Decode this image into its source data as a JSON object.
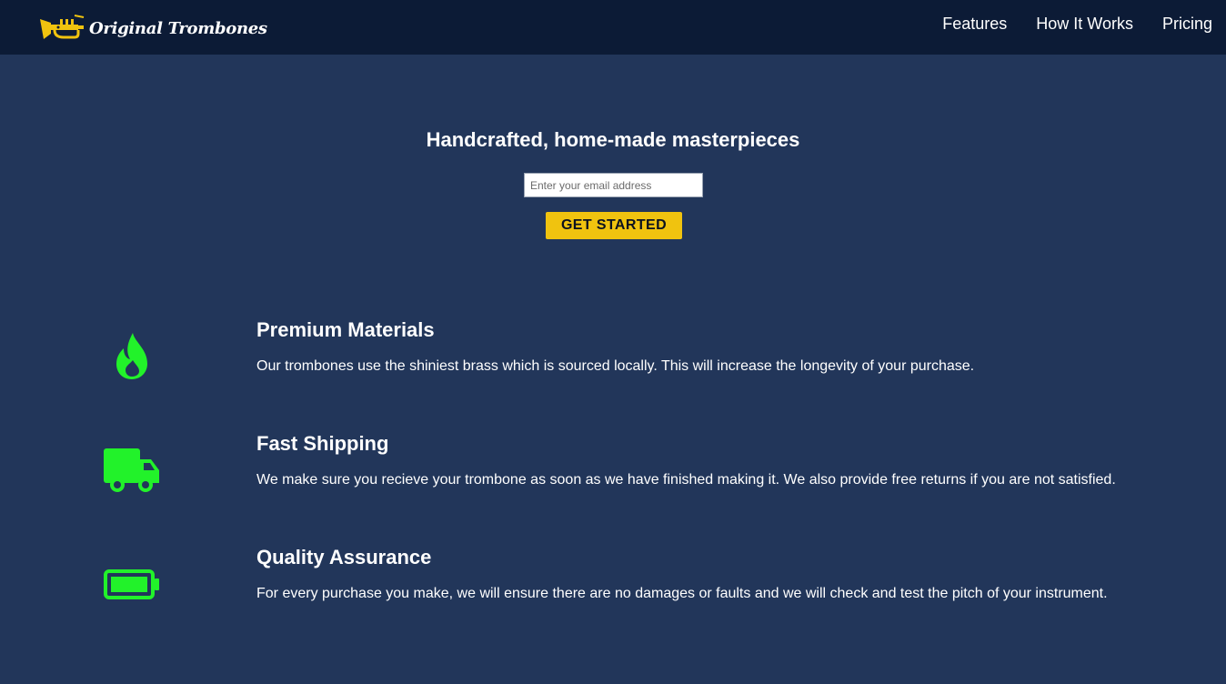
{
  "brand": {
    "name": "Original Trombones",
    "logo_icon": "trumpet-icon",
    "logo_color": "#f0c30f"
  },
  "nav": {
    "items": [
      {
        "label": "Features"
      },
      {
        "label": "How It Works"
      },
      {
        "label": "Pricing"
      }
    ]
  },
  "hero": {
    "title": "Handcrafted, home-made masterpieces",
    "email_placeholder": "Enter your email address",
    "email_value": "",
    "cta_label": "GET STARTED"
  },
  "features": [
    {
      "icon": "fire-icon",
      "title": "Premium Materials",
      "description": "Our trombones use the shiniest brass which is sourced locally. This will increase the longevity of your purchase."
    },
    {
      "icon": "truck-icon",
      "title": "Fast Shipping",
      "description": "We make sure you recieve your trombone as soon as we have finished making it. We also provide free returns if you are not satisfied."
    },
    {
      "icon": "battery-full-icon",
      "title": "Quality Assurance",
      "description": "For every purchase you make, we will ensure there are no damages or faults and we will check and test the pitch of your instrument."
    }
  ],
  "colors": {
    "header_bg": "#0c1b36",
    "page_bg": "#22365a",
    "accent": "#f0c30f",
    "icon_green": "#22f22a"
  }
}
